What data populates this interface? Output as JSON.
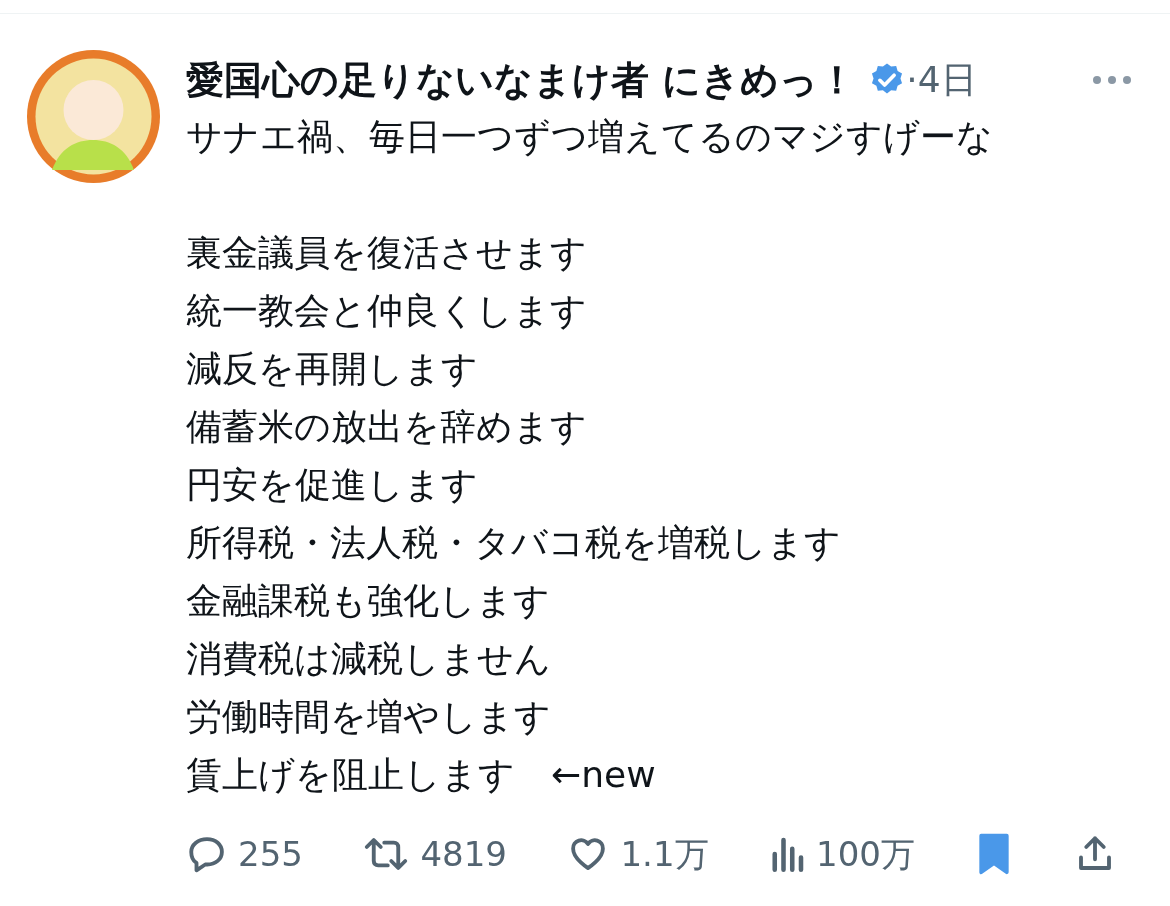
{
  "post": {
    "author": "愛国心の足りないなまけ者 にきめっ！",
    "verified": true,
    "time": "·4日",
    "intro": "サナエ禍、毎日一つずつ増えてるのマジすげーな",
    "lines": [
      "裏金議員を復活させます",
      "統一教会と仲良くします",
      "減反を再開します",
      "備蓄米の放出を辞めます",
      "円安を促進します",
      "所得税・法人税・タバコ税を増税します",
      "金融課税も強化します",
      "消費税は減税しません",
      "労働時間を増やします",
      "賃上げを阻止します　←new"
    ]
  },
  "actions": [
    {
      "kind": "reply",
      "count": "255"
    },
    {
      "kind": "repost",
      "count": "4819"
    },
    {
      "kind": "like",
      "count": "1.1万"
    },
    {
      "kind": "views",
      "count": "100万"
    },
    {
      "kind": "bookmark",
      "selected": true
    },
    {
      "kind": "share"
    }
  ]
}
